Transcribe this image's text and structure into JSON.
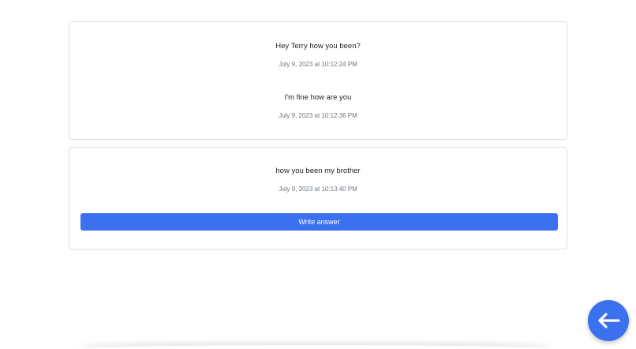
{
  "threads": [
    {
      "messages": [
        {
          "text": "Hey Terry how you been?",
          "time": "July 9, 2023 at 10:12:24 PM"
        },
        {
          "text": "I'm fine how are you",
          "time": "July 9, 2023 at 10:12:36 PM"
        }
      ]
    },
    {
      "messages": [
        {
          "text": "how you been my brother",
          "time": "July 9, 2023 at 10:13:40 PM"
        }
      ],
      "answer_button_label": "Write answer"
    }
  ],
  "back_button": {
    "icon": "arrow-left-icon",
    "color": "#3b71ef"
  },
  "colors": {
    "accent": "#3b71ef",
    "muted_text": "#6c757d",
    "border": "#dcdfe3"
  }
}
